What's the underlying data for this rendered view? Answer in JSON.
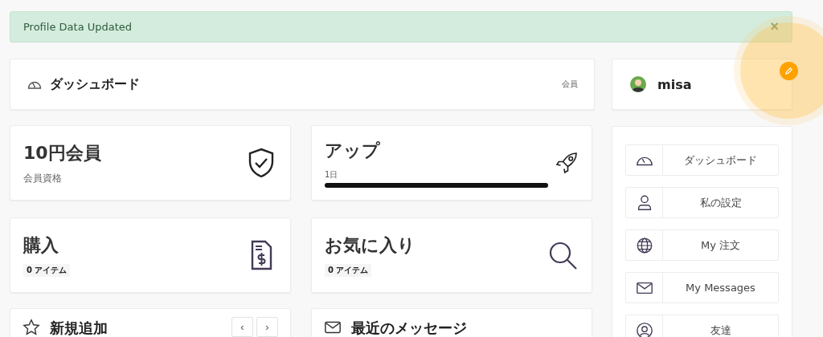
{
  "alert": {
    "message": "Profile Data Updated",
    "dismiss": "×"
  },
  "header": {
    "title": "ダッシュボード",
    "badge": "会員"
  },
  "stats": [
    {
      "kind": "subtitle",
      "title": "10円会員",
      "text": "会員資格"
    },
    {
      "kind": "progress",
      "title": "アップ",
      "text": "1日",
      "level": 1
    },
    {
      "kind": "count",
      "title": "購入",
      "text": "0 アイテム"
    },
    {
      "kind": "count",
      "title": "お気に入り",
      "text": "0 アイテム"
    }
  ],
  "panels": [
    {
      "title": "新規追加",
      "pager": [
        "‹",
        "›"
      ]
    },
    {
      "title": "最近のメッセージ"
    }
  ],
  "profile": {
    "name": "misa"
  },
  "menu": [
    {
      "label": "ダッシュボード"
    },
    {
      "label": "私の設定"
    },
    {
      "label": "My 注文"
    },
    {
      "label": "My Messages"
    },
    {
      "label": "友達"
    }
  ]
}
